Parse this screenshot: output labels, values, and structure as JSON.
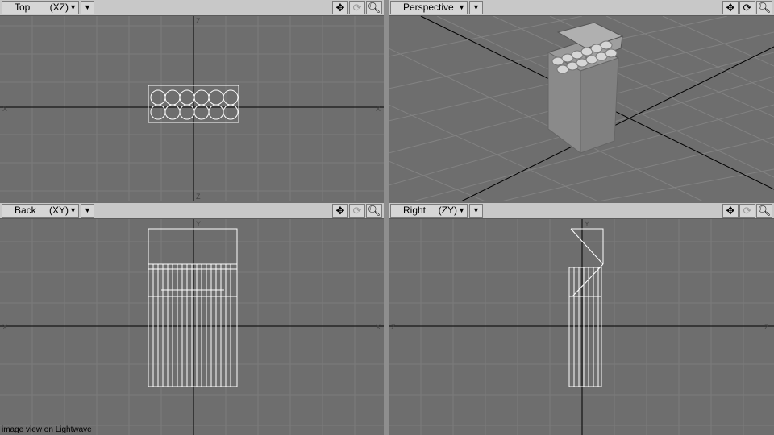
{
  "viewports": {
    "top": {
      "name": "Top",
      "axes": "(XZ)"
    },
    "persp": {
      "name": "Perspective",
      "axes": ""
    },
    "back": {
      "name": "Back",
      "axes": "(XY)"
    },
    "right": {
      "name": "Right",
      "axes": "(ZY)"
    }
  },
  "toolbar_icons": [
    "move-view-icon",
    "rotate-view-icon",
    "zoom-view-icon"
  ],
  "axis_letters": {
    "x": "X",
    "y": "Y",
    "z": "Z"
  },
  "caption": "image view on Lightwave",
  "colors": {
    "viewport_bg": "#6e6e6e",
    "grid": "#7c7c7c",
    "axis": "#000000",
    "wire": "#ffffff"
  }
}
